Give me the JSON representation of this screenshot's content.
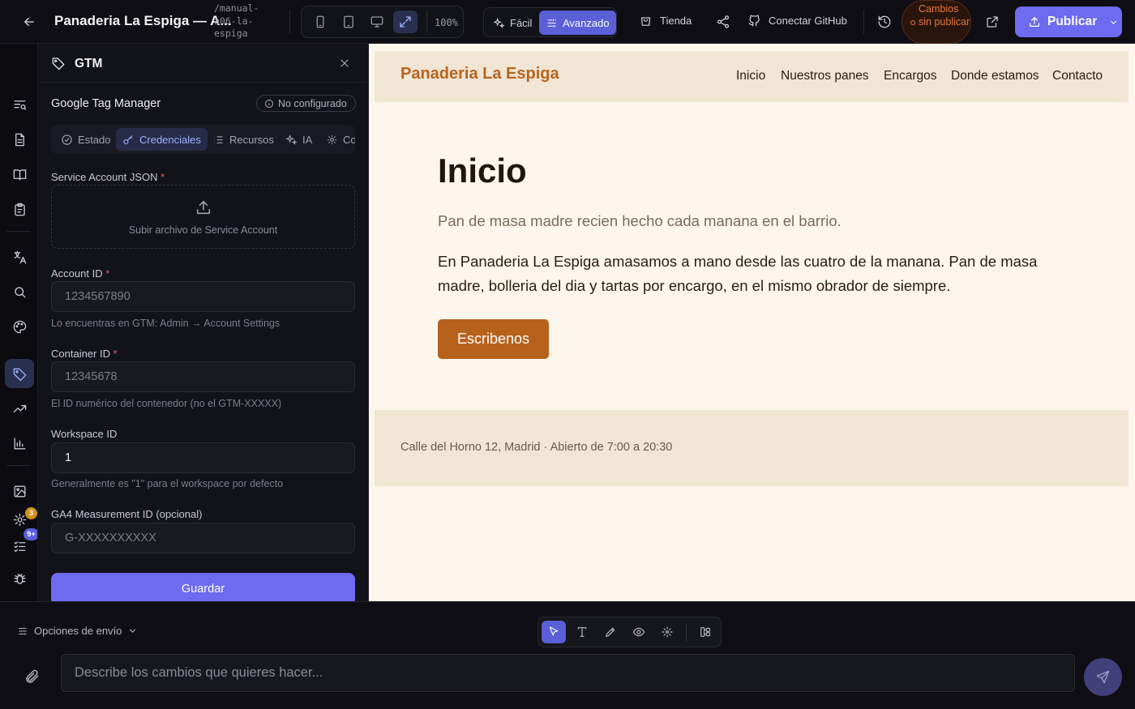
{
  "header": {
    "title": "Panaderia La Espiga — A...",
    "slug": "/manual-a06-la-espiga",
    "zoom": "100%",
    "modes": {
      "easy": "Fácil",
      "advanced": "Avanzado"
    },
    "store": "Tienda",
    "github": "Conectar GitHub",
    "unsaved": "Cambios sin publicar",
    "publish": "Publicar"
  },
  "rail": {
    "badge_count": "3",
    "badge_more": "9+",
    "badge_colors": {
      "count": "#d4921c",
      "more": "#5b5fd8"
    }
  },
  "panel": {
    "title": "GTM",
    "service_name": "Google Tag Manager",
    "status": "No configurado",
    "tabs": [
      "Estado",
      "Credenciales",
      "Recursos",
      "IA",
      "Configuración"
    ],
    "service_json": {
      "label": "Service Account JSON",
      "required": "*",
      "upload": "Subir archivo de Service Account"
    },
    "account_id": {
      "label": "Account ID",
      "required": "*",
      "placeholder": "1234567890",
      "help": "Lo encuentras en GTM: Admin → Account Settings"
    },
    "container_id": {
      "label": "Container ID",
      "required": "*",
      "placeholder": "12345678",
      "help": "El ID numérico del contenedor (no el GTM-XXXXX)"
    },
    "workspace_id": {
      "label": "Workspace ID",
      "value": "1",
      "help": "Generalmente es \"1\" para el workspace por defecto"
    },
    "ga4": {
      "label": "GA4 Measurement ID (opcional)",
      "placeholder": "G-XXXXXXXXXX"
    },
    "save": "Guardar"
  },
  "site": {
    "brand": "Panaderia La Espiga",
    "nav": [
      "Inicio",
      "Nuestros panes",
      "Encargos",
      "Donde estamos",
      "Contacto"
    ],
    "heading": "Inicio",
    "lead": "Pan de masa madre recien hecho cada manana en el barrio.",
    "body": "En Panaderia La Espiga amasamos a mano desde las cuatro de la manana. Pan de masa madre, bolleria del dia y tartas por encargo, en el mismo obrador de siempre.",
    "cta": "Escribenos",
    "footer": "Calle del Horno 12, Madrid · Abierto de 7:00 a 20:30",
    "colors": {
      "brand": "#b8651f",
      "cta": "#b7621c",
      "bg": "#fdf6ec",
      "band": "#f1e5d4"
    }
  },
  "composer": {
    "options": "Opciones de envío",
    "placeholder": "Describe los cambios que quieres hacer..."
  },
  "icons": [
    "arrow-left-icon",
    "phone-icon",
    "tablet-icon",
    "monitor-icon",
    "expand-icon",
    "sparkles-icon",
    "sliders-icon",
    "bag-icon",
    "share-icon",
    "github-icon",
    "history-icon",
    "external-link-icon",
    "upload-icon",
    "chevron-down-icon",
    "tag-icon",
    "close-icon",
    "info-icon",
    "check-circle-icon",
    "key-icon",
    "list-icon",
    "gear-icon",
    "cursor-icon",
    "text-icon",
    "pencil-icon",
    "eye-icon",
    "magic-icon",
    "hierarchy-icon",
    "paperclip-icon",
    "send-icon"
  ],
  "accent": "#6d6bf0"
}
